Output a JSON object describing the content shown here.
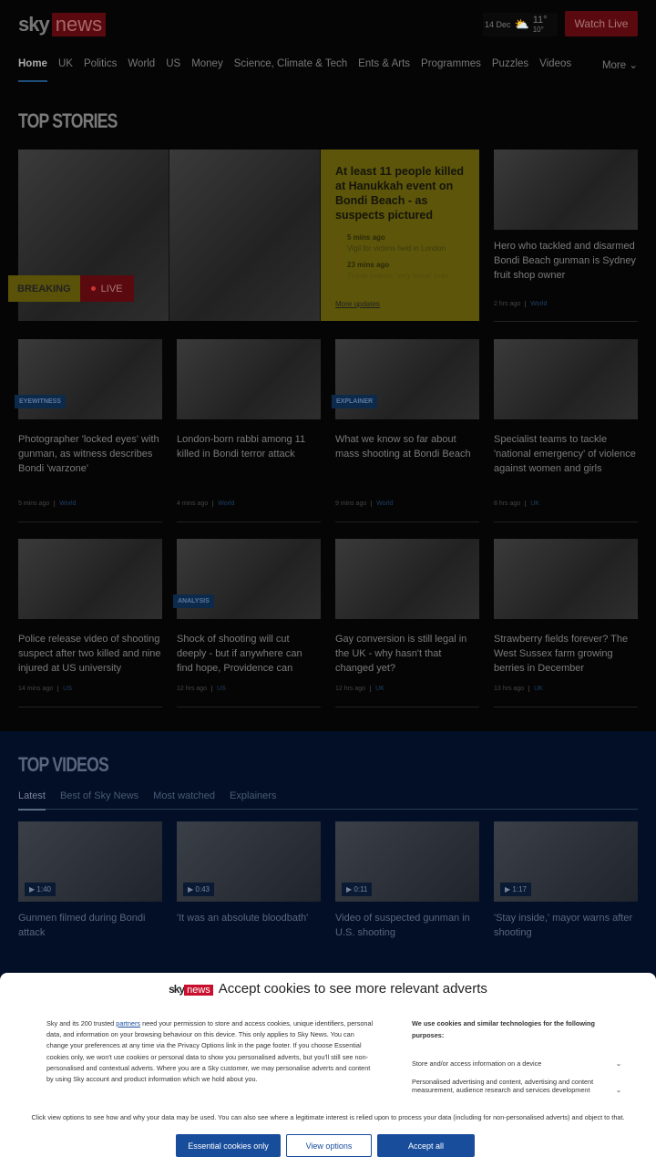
{
  "header": {
    "logo_sky": "sky",
    "logo_news": "news",
    "date": "14 Dec",
    "temp_high": "11°",
    "temp_low": "10°",
    "weather_icon": "partly-cloudy-icon",
    "watch_live": "Watch Live"
  },
  "nav": {
    "items": [
      "Home",
      "UK",
      "Politics",
      "World",
      "US",
      "Money",
      "Science, Climate & Tech",
      "Ents & Arts",
      "Programmes",
      "Puzzles",
      "Videos"
    ],
    "more": "More"
  },
  "top_stories": {
    "title": "TOP STORIES",
    "hero": {
      "breaking": "BREAKING",
      "live": "LIVE",
      "headline": "At least 11 people killed at Hanukkah event on Bondi Beach - as suspects pictured",
      "updates": [
        {
          "time": "5 mins ago",
          "text": "Vigil for victims held in London"
        },
        {
          "time": "23 mins ago",
          "text": "Trump praises 'very brave' man"
        }
      ],
      "more": "More updates"
    },
    "side": {
      "title": "Hero who tackled and disarmed Bondi Beach gunman is Sydney fruit shop owner",
      "time": "2 hrs ago",
      "category": "World"
    },
    "cards": [
      {
        "badge": "EYEWITNESS",
        "title": "Photographer 'locked eyes' with gunman, as witness describes Bondi 'warzone'",
        "time": "5 mins ago",
        "category": "World"
      },
      {
        "badge": "",
        "title": "London-born rabbi among 11 killed in Bondi terror attack",
        "time": "4 mins ago",
        "category": "World"
      },
      {
        "badge": "EXPLAINER",
        "title": "What we know so far about mass shooting at Bondi Beach",
        "time": "9 mins ago",
        "category": "World"
      },
      {
        "badge": "",
        "title": "Specialist teams to tackle 'national emergency' of violence against women and girls",
        "time": "8 hrs ago",
        "category": "UK"
      },
      {
        "badge": "",
        "title": "Police release video of shooting suspect after two killed and nine injured at US university",
        "time": "14 mins ago",
        "category": "US"
      },
      {
        "badge": "ANALYSIS",
        "title": "Shock of shooting will cut deeply - but if anywhere can find hope, Providence can",
        "time": "12 hrs ago",
        "category": "US"
      },
      {
        "badge": "",
        "title": "Gay conversion is still legal in the UK - why hasn't that changed yet?",
        "time": "12 hrs ago",
        "category": "UK"
      },
      {
        "badge": "",
        "title": "Strawberry fields forever? The West Sussex farm growing berries in December",
        "time": "13 hrs ago",
        "category": "UK"
      }
    ]
  },
  "top_videos": {
    "title": "TOP VIDEOS",
    "tabs": [
      "Latest",
      "Best of Sky News",
      "Most watched",
      "Explainers"
    ],
    "items": [
      {
        "duration": "1:40",
        "title": "Gunmen filmed during Bondi attack"
      },
      {
        "duration": "0:43",
        "title": "'It was an absolute bloodbath'"
      },
      {
        "duration": "0:11",
        "title": "Video of suspected gunman in U.S. shooting"
      },
      {
        "duration": "1:17",
        "title": "'Stay inside,' mayor warns after shooting"
      }
    ]
  },
  "cookie": {
    "logo_sky": "sky",
    "logo_news": "news",
    "title": "Accept cookies to see more relevant adverts",
    "text_before": "Sky and its 200 trusted ",
    "link": "partners",
    "text_after": " need your permission to store and access cookies, unique identifiers, personal data, and information on your browsing behaviour on this device. This only applies to Sky News. You can change your preferences at any time via the Privacy Options link in the page footer. If you choose Essential cookies only, we won't use cookies or personal data to show you personalised adverts, but you'll still see non-personalised and contextual adverts. Where you are a Sky customer, we may personalise adverts and content by using Sky account and product information which we hold about you.",
    "purposes_title": "We use cookies and similar technologies for the following purposes:",
    "purposes": [
      "Store and/or access information on a device",
      "Personalised advertising and content, advertising and content measurement, audience research and services development"
    ],
    "footer": "Click view options to see how and why your data may be used. You can also see where a legitimate interest is relied upon to process your data (including for non-personalised adverts) and object to that.",
    "essential": "Essential cookies only",
    "options": "View options",
    "accept": "Accept all"
  },
  "colors": {
    "brand_red": "#c8102e",
    "breaking_yellow": "#f2e21b",
    "button_blue": "#184d9c"
  }
}
